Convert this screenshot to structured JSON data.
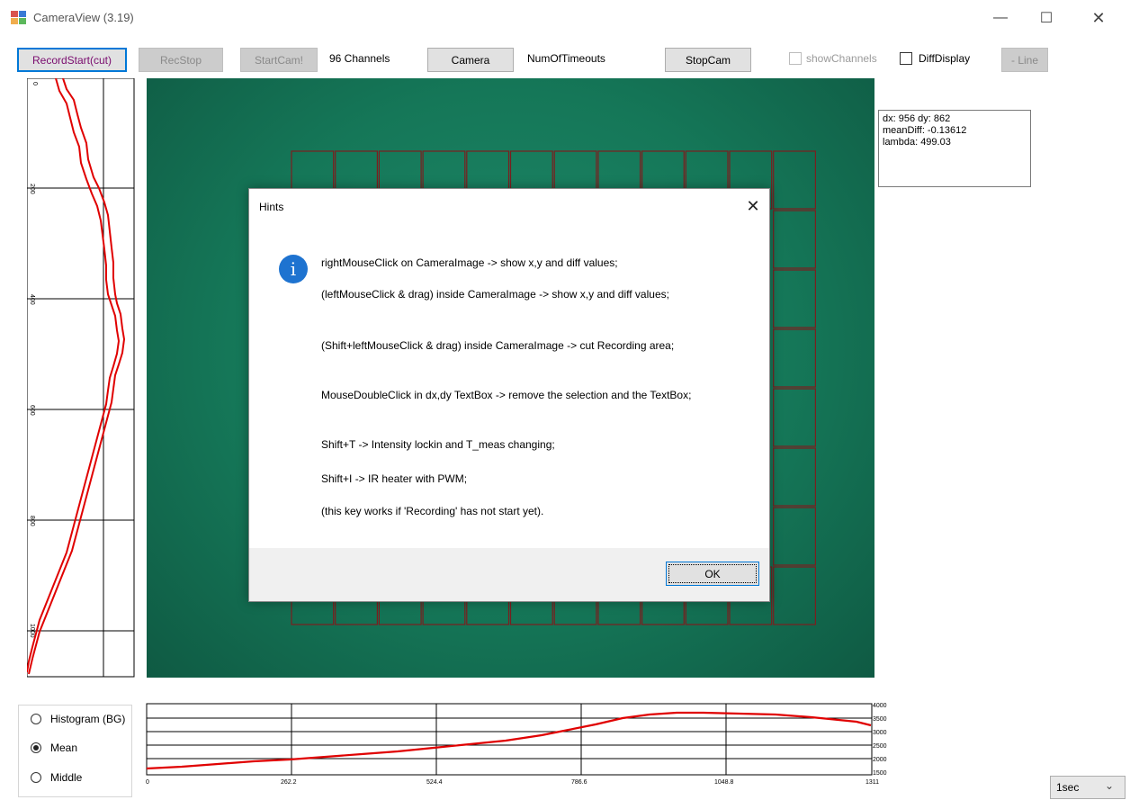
{
  "window": {
    "title": "CameraView (3.19)",
    "icon": "app-window-icon",
    "controls": [
      "minimize-icon",
      "maximize-icon",
      "close-icon"
    ]
  },
  "toolbar": {
    "record_start": "RecordStart(cut)",
    "rec_stop": "RecStop",
    "start_cam": "StartCam!",
    "channels_label": "96 Channels",
    "camera": "Camera",
    "timeouts_label": "NumOfTimeouts",
    "stop_cam": "StopCam",
    "show_channels": "showChannels",
    "show_channels_checked": false,
    "show_channels_enabled": false,
    "diff_display": "DiffDisplay",
    "diff_display_checked": false,
    "line": "- Line"
  },
  "info_box": {
    "line1": "dx: 956  dy: 862",
    "line2": "meanDiff: -0.13612",
    "line3": "lambda: 499.03"
  },
  "camera_image": {
    "background_color": "#157758",
    "grid_color": "#7a1f1f"
  },
  "left_plot": {
    "tick_labels": [
      "0",
      "200",
      "400",
      "600",
      "800",
      "1000"
    ]
  },
  "bottom_plot": {
    "x_tick_labels": [
      "0",
      "262.2",
      "524.4",
      "786.6",
      "1048.8",
      "1311"
    ],
    "y_tick_labels": [
      "4000",
      "3500",
      "3000",
      "2500",
      "2000",
      "1500"
    ]
  },
  "dialog": {
    "title": "Hints",
    "icon": "info-icon",
    "hints": [
      "rightMouseClick on CameraImage -> show x,y and diff values;",
      "(leftMouseClick & drag) inside CameraImage -> show x,y and diff values;",
      "(Shift+leftMouseClick & drag) inside CameraImage -> cut Recording area;",
      "MouseDoubleClick in dx,dy TextBox -> remove the selection and the TextBox;",
      "Shift+T -> Intensity lockin and T_meas changing;",
      "Shift+I -> IR heater with PWM;",
      "(this key works if 'Recording' has not start yet)."
    ],
    "ok": "OK"
  },
  "radio_group": {
    "options": [
      "Histogram (BG)",
      "Mean",
      "Middle"
    ],
    "selected": "Mean"
  },
  "interval_combo": {
    "value": "1sec"
  },
  "colors": {
    "plot_line": "#e00000",
    "accent": "#0078d7",
    "info_icon": "#1e73d0"
  }
}
